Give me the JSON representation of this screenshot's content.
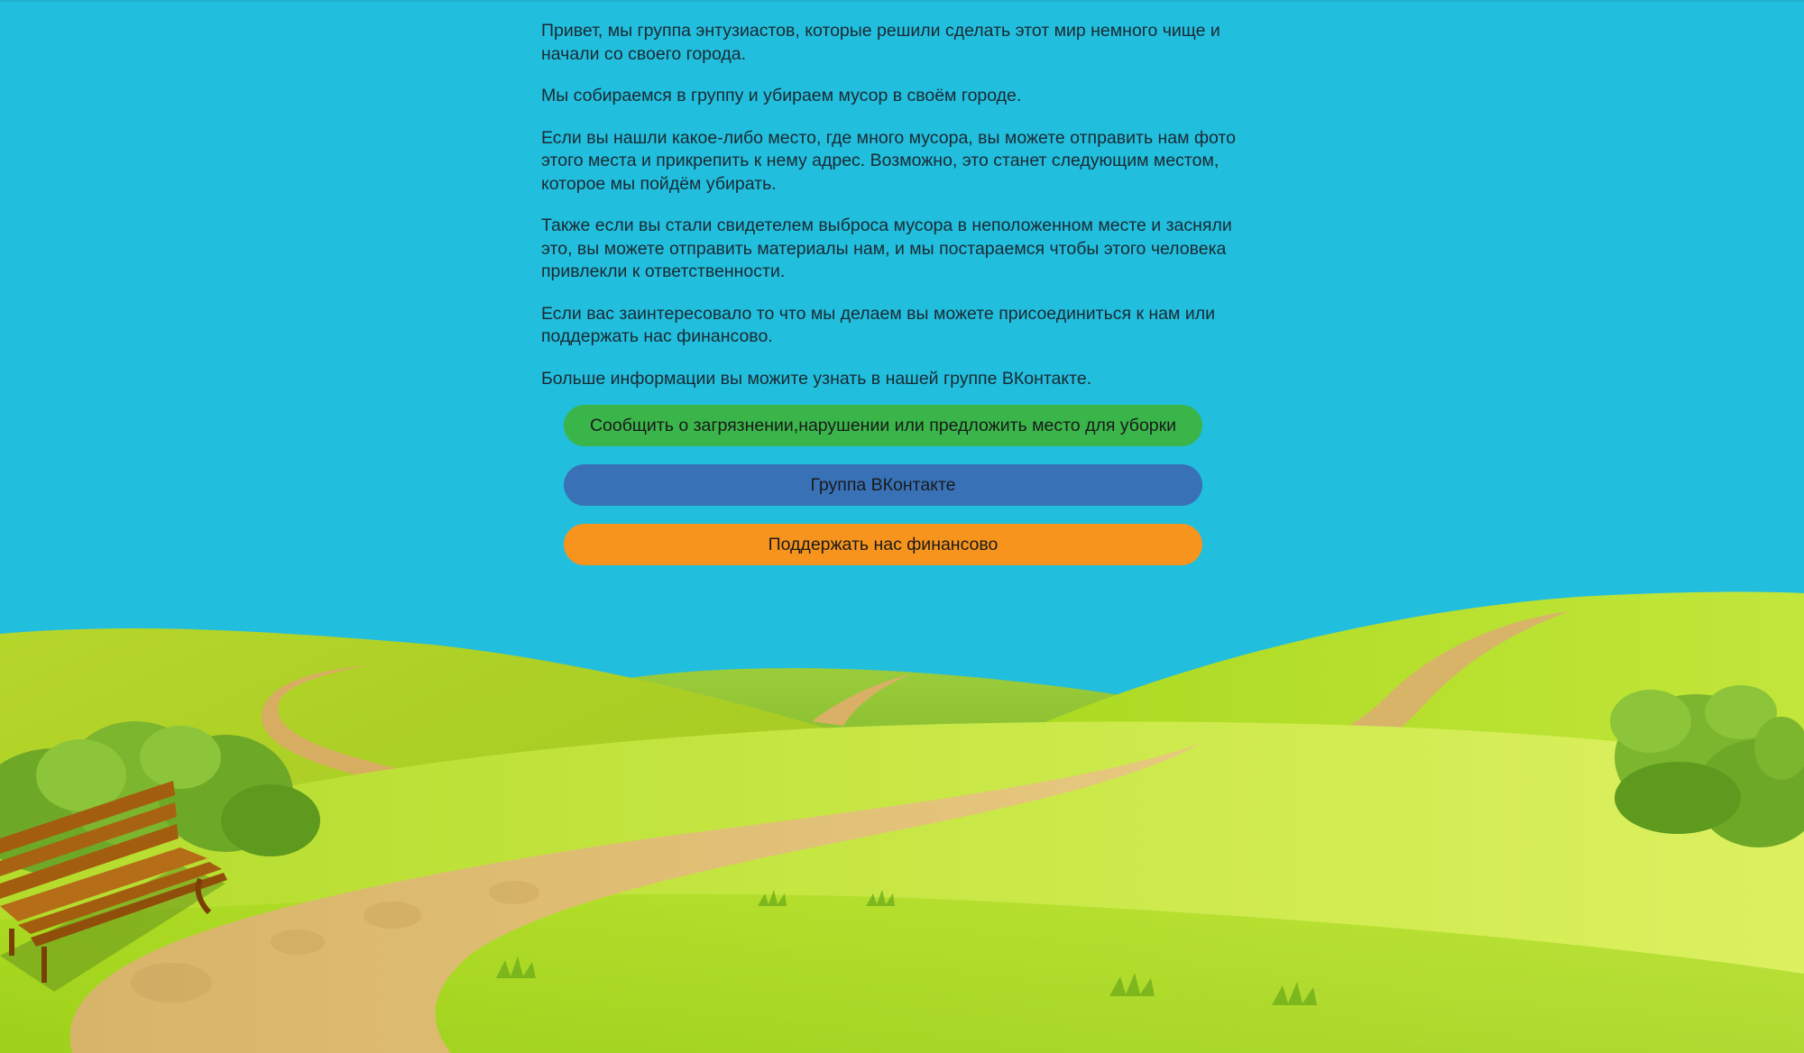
{
  "intro": {
    "paragraphs": [
      "Привет, мы группа энтузиастов, которые решили сделать этот мир немного чище и начали со своего города.",
      "Мы собираемся в группу и убираем мусор в своём городе.",
      "Если вы нашли какое-либо место, где много мусора, вы можете отправить нам фото этого места и прикрепить к нему адрес. Возможно, это станет следующим местом, которое мы пойдём убирать.",
      "Также если вы стали свидетелем выброса мусора в неположенном месте и засняли это, вы можете отправить материалы нам, и мы постараемся чтобы этого человека привлекли к ответственности.",
      "Если вас заинтересовало то что мы делаем вы можете присоединиться к нам или поддержать нас финансово.",
      "Больше информации вы можите узнать в нашей группе ВКонтакте."
    ]
  },
  "actions": {
    "report_label": "Сообщить о загрязнении,нарушении или предложить место для уборки",
    "vk_group_label": "Группа ВКонтакте",
    "donate_label": "Поддержать нас финансово"
  },
  "colors": {
    "sky": "#22bedd",
    "report_button": "#3ab54a",
    "vk_button": "#3871b6",
    "donate_button": "#f7941d"
  }
}
